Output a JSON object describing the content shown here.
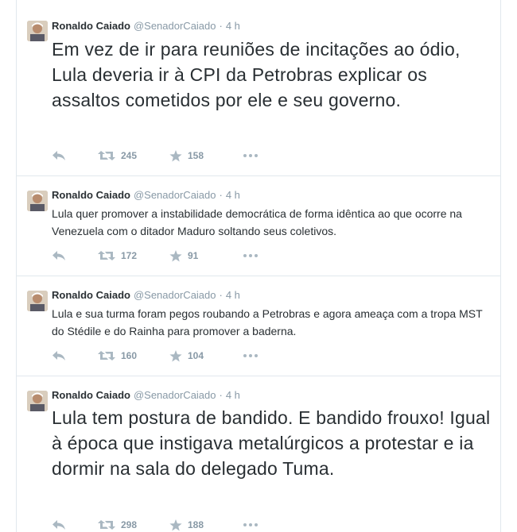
{
  "tweets": [
    {
      "name": "Ronaldo Caiado",
      "handle": "@SenadorCaiado",
      "time": "4 h",
      "separator": "·",
      "text": "Em vez de ir para reuniões de incitações ao ódio, Lula deveria ir à CPI da Petrobras explicar os assaltos cometidos por ele e seu governo.",
      "retweets": "245",
      "favorites": "158"
    },
    {
      "name": "Ronaldo Caiado",
      "handle": "@SenadorCaiado",
      "time": "4 h",
      "separator": "·",
      "text": "Lula quer promover a instabilidade democrática de forma idêntica ao que ocorre na Venezuela com o ditador Maduro soltando seus coletivos.",
      "retweets": "172",
      "favorites": "91"
    },
    {
      "name": "Ronaldo Caiado",
      "handle": "@SenadorCaiado",
      "time": "4 h",
      "separator": "·",
      "text": "Lula e sua turma foram pegos roubando a Petrobras e agora ameaça com a tropa MST do Stédile e do Rainha para promover a baderna.",
      "retweets": "160",
      "favorites": "104"
    },
    {
      "name": "Ronaldo Caiado",
      "handle": "@SenadorCaiado",
      "time": "4 h",
      "separator": "·",
      "text": "Lula tem postura de bandido. E bandido frouxo! Igual à época que instigava metalúrgicos a protestar e ia dormir na sala do delegado Tuma.",
      "retweets": "298",
      "favorites": "188"
    }
  ],
  "colors": {
    "muted": "#8899a6",
    "icon": "#aab8c2",
    "text": "#292f33",
    "border": "#e1e8ed"
  }
}
